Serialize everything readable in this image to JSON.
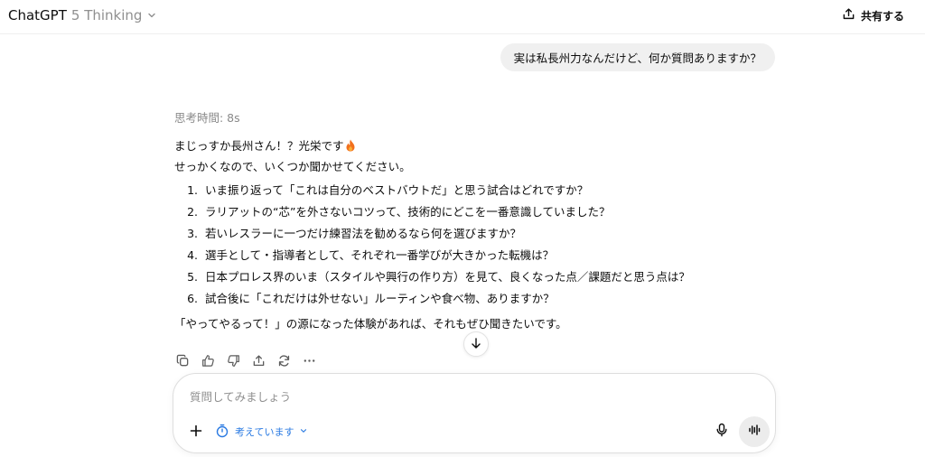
{
  "header": {
    "brand": "ChatGPT",
    "model": "5 Thinking",
    "share_label": "共有する"
  },
  "user_message": "実は私長州力なんだけど、何か質問ありますか？",
  "assistant": {
    "thinking_label": "思考時間: 8s",
    "greeting": "まじっすか長州さん！？光栄です",
    "greeting_emoji": "fire",
    "intro": "せっかくなので、いくつか聞かせてください。",
    "questions": [
      {
        "num": "1.",
        "text": "いま振り返って「これは自分のベストバウトだ」と思う試合はどれですか？"
      },
      {
        "num": "2.",
        "text": "ラリアットの“芯”を外さないコツって、技術的にどこを一番意識していました？"
      },
      {
        "num": "3.",
        "text": "若いレスラーに一つだけ練習法を勧めるなら何を選びますか？"
      },
      {
        "num": "4.",
        "text": "選手として・指導者として、それぞれ一番学びが大きかった転機は？"
      },
      {
        "num": "5.",
        "text": "日本プロレス界のいま（スタイルや興行の作り方）を見て、良くなった点／課題だと思う点は？"
      },
      {
        "num": "6.",
        "text": "試合後に「これだけは外せない」ルーティンや食べ物、ありますか？"
      }
    ],
    "closing": "「やってやるって！」の源になった体験があれば、それもぜひ聞きたいです。"
  },
  "actions": [
    "copy-icon",
    "thumbs-up-icon",
    "thumbs-down-icon",
    "share-icon",
    "regenerate-icon",
    "more-icon"
  ],
  "composer": {
    "placeholder": "質問してみましょう",
    "mode_label": "考えています"
  },
  "colors": {
    "accent": "#2a7ae2",
    "bubble": "#f0f0f0",
    "muted": "#8f8f8f",
    "flame": "#f2701c"
  }
}
